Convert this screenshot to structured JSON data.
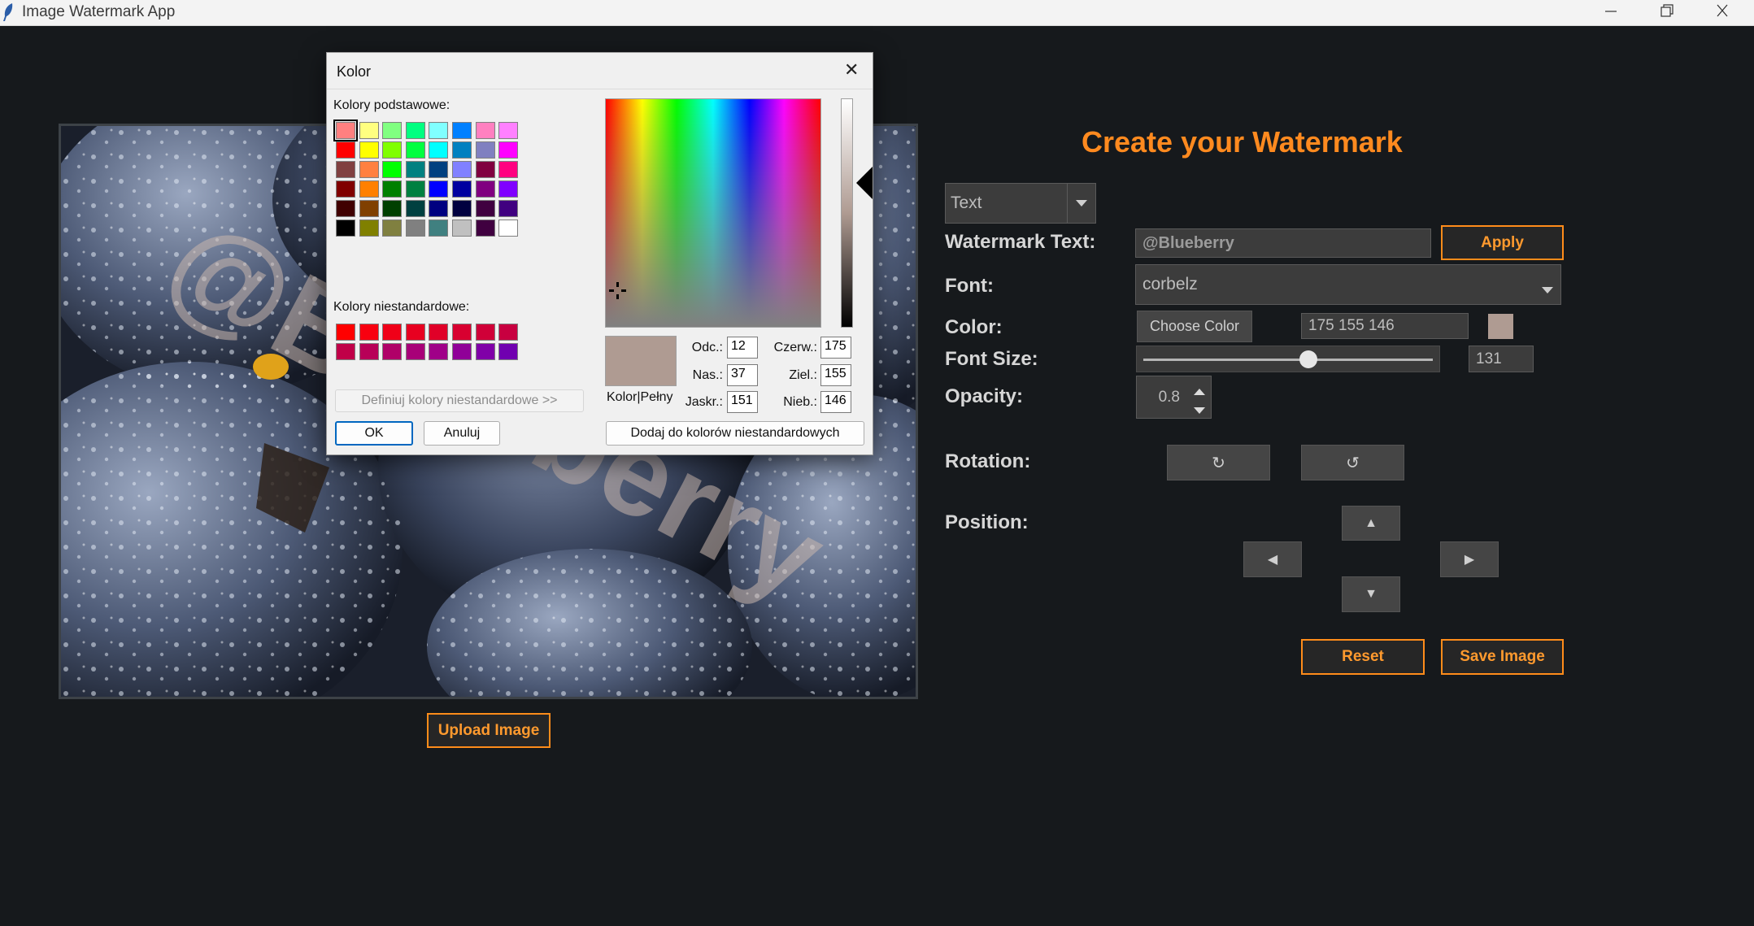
{
  "window": {
    "title": "Image Watermark App"
  },
  "image": {
    "watermark_text": "@Blueberry",
    "watermark_visible_1": "@B",
    "watermark_visible_2": "berry"
  },
  "upload_button": "Upload Image",
  "panel": {
    "heading": "Create your Watermark",
    "mode_select": "Text",
    "watermark_text_label": "Watermark Text:",
    "watermark_text_value": "@Blueberry",
    "apply_label": "Apply",
    "font_label": "Font:",
    "font_value": "corbelz",
    "color_label": "Color:",
    "choose_color_label": "Choose Color",
    "color_value": "175 155 146",
    "color_swatch": "#af9b92",
    "font_size_label": "Font Size:",
    "font_size_value": "131",
    "font_size_slider_fraction": 0.57,
    "opacity_label": "Opacity:",
    "opacity_value": "0.8",
    "rotation_label": "Rotation:",
    "rotate_cw_icon": "↻",
    "rotate_ccw_icon": "↺",
    "position_label": "Position:",
    "arrow_up": "▲",
    "arrow_left": "◀",
    "arrow_right": "▶",
    "arrow_down": "▼",
    "reset_label": "Reset",
    "save_label": "Save Image"
  },
  "dialog": {
    "title": "Kolor",
    "close_icon": "✕",
    "basic_colors_label": "Kolory podstawowe:",
    "basic_colors": [
      [
        "#ff8080",
        "#ffff80",
        "#80ff80",
        "#00ff80",
        "#80ffff",
        "#0080ff",
        "#ff80c0",
        "#ff80ff"
      ],
      [
        "#ff0000",
        "#ffff00",
        "#80ff00",
        "#00ff40",
        "#00ffff",
        "#0080c0",
        "#8080c0",
        "#ff00ff"
      ],
      [
        "#804040",
        "#ff8040",
        "#00ff00",
        "#008080",
        "#004080",
        "#8080ff",
        "#800040",
        "#ff0080"
      ],
      [
        "#800000",
        "#ff8000",
        "#008000",
        "#008040",
        "#0000ff",
        "#0000a0",
        "#800080",
        "#8000ff"
      ],
      [
        "#400000",
        "#804000",
        "#004000",
        "#004040",
        "#000080",
        "#000040",
        "#400040",
        "#400080"
      ],
      [
        "#000000",
        "#808000",
        "#808040",
        "#808080",
        "#408080",
        "#c0c0c0",
        "#400040",
        "#ffffff"
      ]
    ],
    "custom_colors_label": "Kolory niestandardowe:",
    "custom_colors": [
      [
        "#ff0000",
        "#f80010",
        "#f00018",
        "#e80020",
        "#e00028",
        "#d80030",
        "#d00038",
        "#c80040"
      ],
      [
        "#c00048",
        "#b80058",
        "#b00068",
        "#a80078",
        "#a00088",
        "#900098",
        "#8000a8",
        "#7000b0"
      ]
    ],
    "define_custom_label": "Definiuj kolory niestandardowe >>",
    "ok_label": "OK",
    "cancel_label": "Anuluj",
    "preview_label": "Kolor|Pełny",
    "preview_color": "#af9b92",
    "hue_label": "Odc.:",
    "hue_value": "12",
    "sat_label": "Nas.:",
    "sat_value": "37",
    "lum_label": "Jaskr.:",
    "lum_value": "151",
    "red_label": "Czerw.:",
    "red_value": "175",
    "green_label": "Ziel.:",
    "green_value": "155",
    "blue_label": "Nieb.:",
    "blue_value": "146",
    "add_custom_label": "Dodaj do kolorów niestandardowych"
  }
}
